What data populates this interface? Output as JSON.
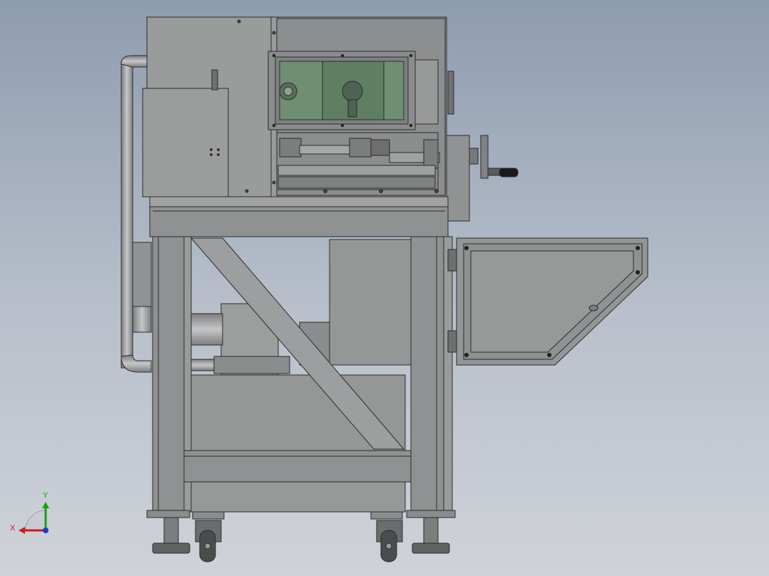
{
  "view": {
    "title": "",
    "background_top": "#8e9cb0",
    "background_bottom": "#cfd2d8"
  },
  "model": {
    "frame_color": "#8f9192",
    "panel_color": "#959797",
    "glass_color": "#6f8f72",
    "edge_color": "#2b2b2b"
  },
  "triad": {
    "x_label": "X",
    "y_label": "Y",
    "x_color": "#d01818",
    "y_color": "#18a018",
    "z_color": "#1e3cc8"
  }
}
